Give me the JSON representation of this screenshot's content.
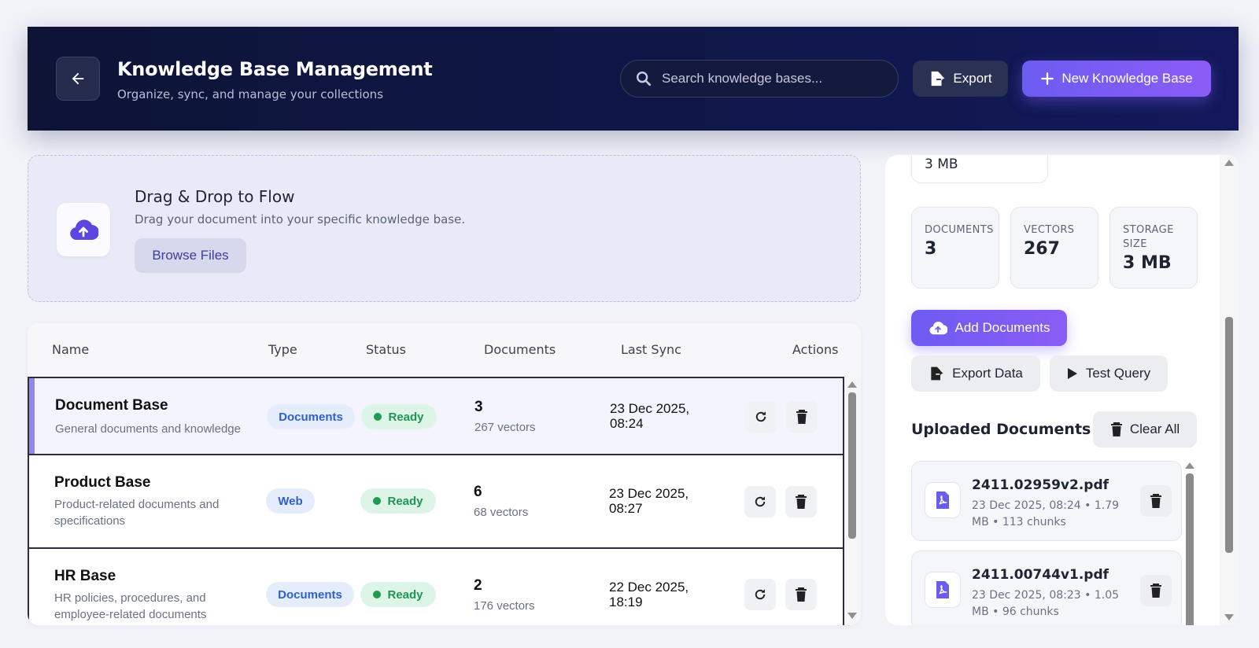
{
  "header": {
    "title": "Knowledge Base Management",
    "subtitle": "Organize, sync, and manage your collections",
    "search_placeholder": "Search knowledge bases...",
    "export_label": "Export",
    "new_label": "New Knowledge Base"
  },
  "dropzone": {
    "title": "Drag & Drop to Flow",
    "description": "Drag your document into your specific knowledge base.",
    "browse_label": "Browse Files"
  },
  "table": {
    "columns": [
      "Name",
      "Type",
      "Status",
      "Documents",
      "Last Sync",
      "Actions"
    ],
    "rows": [
      {
        "name": "Document Base",
        "description": "General documents and knowledge",
        "type": "Documents",
        "status": "Ready",
        "documents": "3",
        "vectors": "267 vectors",
        "last_sync_date": "23 Dec 2025,",
        "last_sync_time": "08:24"
      },
      {
        "name": "Product Base",
        "description": "Product-related documents and specifications",
        "type": "Web",
        "status": "Ready",
        "documents": "6",
        "vectors": "68 vectors",
        "last_sync_date": "23 Dec 2025,",
        "last_sync_time": "08:27"
      },
      {
        "name": "HR Base",
        "description": "HR policies, procedures, and employee-related documents",
        "type": "Documents",
        "status": "Ready",
        "documents": "2",
        "vectors": "176 vectors",
        "last_sync_date": "22 Dec 2025,",
        "last_sync_time": "18:19"
      }
    ]
  },
  "details": {
    "top_partial_value": "3 MB",
    "stats": [
      {
        "label": "DOCUMENTS",
        "value": "3"
      },
      {
        "label": "VECTORS",
        "value": "267"
      },
      {
        "label": "STORAGE SIZE",
        "value": "3 MB"
      }
    ],
    "add_documents_label": "Add Documents",
    "export_data_label": "Export Data",
    "test_query_label": "Test Query",
    "uploaded_title": "Uploaded Documents",
    "clear_all_label": "Clear All",
    "files": [
      {
        "name": "2411.02959v2.pdf",
        "meta": "23 Dec 2025, 08:24 • 1.79 MB • 113 chunks"
      },
      {
        "name": "2411.00744v1.pdf",
        "meta": "23 Dec 2025, 08:23 • 1.05 MB • 96 chunks"
      }
    ]
  },
  "colors": {
    "header_bg": "#0e1436",
    "accent": "#7c5cf6",
    "ready_green": "#1f9651",
    "type_blue": "#2f5fd4"
  }
}
